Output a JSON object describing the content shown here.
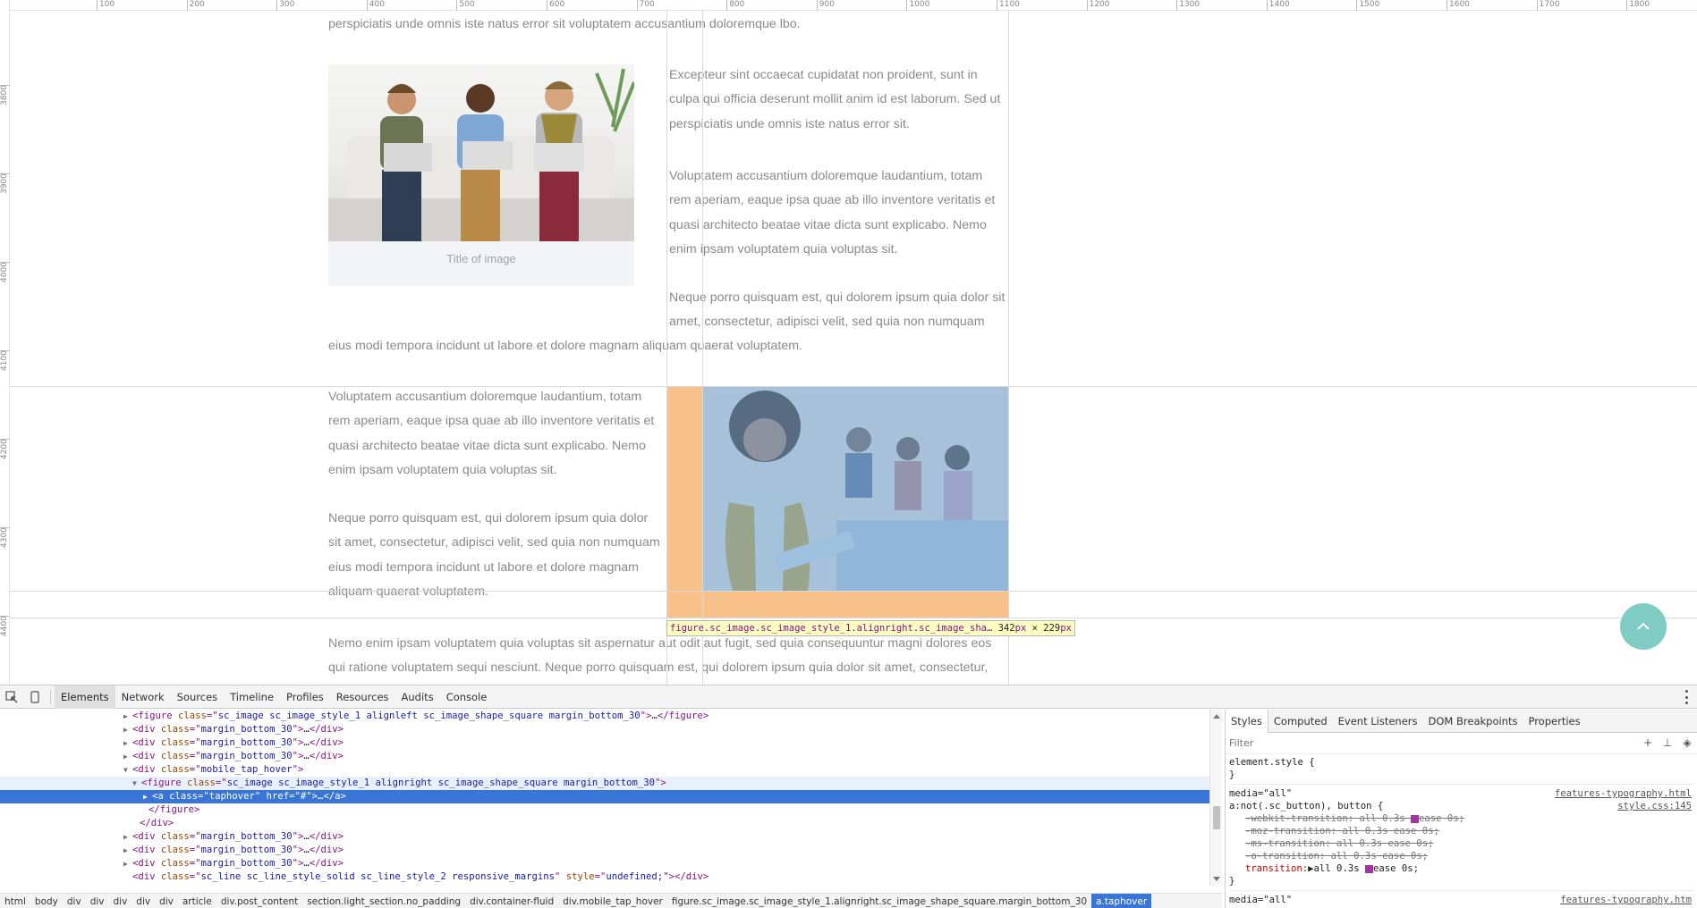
{
  "page": {
    "text_top": "perspiciatis unde omnis iste natus error sit voluptatem accusantium doloremque lbo.",
    "right_paragraphs": [
      "Excepteur sint occaecat cupidatat non proident, sunt in culpa qui officia deserunt mollit anim id est laborum. Sed ut perspiciatis unde omnis iste natus error sit.",
      "Voluptatem accusantium doloremque laudantium, totam rem aperiam, eaque ipsa quae ab illo inventore veritatis et quasi architecto beatae vitae dicta sunt explicabo. Nemo enim ipsam voluptatem quia voluptas sit.",
      "Neque porro quisquam est, qui dolorem ipsum quia dolor sit amet, consectetur, adipisci velit, sed quia non numquam"
    ],
    "wrap_line": "eius modi tempora incidunt ut labore et dolore magnam aliquam quaerat voluptatem.",
    "image_caption": "Title of image",
    "left_paragraphs": [
      "Voluptatem accusantium doloremque laudantium, totam rem aperiam, eaque ipsa quae ab illo inventore veritatis et quasi architecto beatae vitae dicta sunt explicabo. Nemo enim ipsam voluptatem quia voluptas sit.",
      "Neque porro quisquam est, qui dolorem ipsum quia dolor sit amet, consectetur, adipisci velit, sed quia non numquam eius modi tempora incidunt ut labore et dolore magnam aliquam quaerat voluptatem."
    ],
    "bottom_paragraph": "Nemo enim ipsam voluptatem quia voluptas sit aspernatur aut odit aut fugit, sed quia consequuntur magni dolores eos qui ratione voluptatem sequi nesciunt. Neque porro quisquam est, qui dolorem ipsum quia dolor sit amet, consectetur, adipisci velit, sed quia non",
    "scroll_top_icon": "chevron-up-icon",
    "accent_color": "#7fccc5"
  },
  "rulers": {
    "horizontal": [
      "100",
      "200",
      "300",
      "400",
      "500",
      "600",
      "700",
      "800",
      "900",
      "1000",
      "1100",
      "1200",
      "1300",
      "1400",
      "1500",
      "1600",
      "1700",
      "1800"
    ],
    "vertical": [
      "3800",
      "3900",
      "4000",
      "4100",
      "4200",
      "4300",
      "4400"
    ]
  },
  "inspect_tooltip": {
    "selector": "figure.sc_image.sc_image_style_1.alignright.sc_image_sha…",
    "width": "342",
    "height": "229",
    "unit": "px",
    "times": "×"
  },
  "devtools": {
    "tabs": [
      "Elements",
      "Network",
      "Sources",
      "Timeline",
      "Profiles",
      "Resources",
      "Audits",
      "Console"
    ],
    "active_tab": "Elements",
    "dom_lines": [
      {
        "tri": "▶",
        "html": [
          [
            "t",
            "<figure "
          ],
          [
            "an",
            "class"
          ],
          [
            "t",
            "=\""
          ],
          [
            "av",
            "sc_image sc_image_style_1 alignleft sc_image_shape_square margin_bottom_30"
          ],
          [
            "t",
            "\">"
          ],
          [
            "el",
            "…"
          ],
          [
            "t",
            "</figure>"
          ]
        ]
      },
      {
        "tri": "▶",
        "html": [
          [
            "t",
            "<div "
          ],
          [
            "an",
            "class"
          ],
          [
            "t",
            "=\""
          ],
          [
            "av",
            "margin_bottom_30"
          ],
          [
            "t",
            "\">"
          ],
          [
            "el",
            "…"
          ],
          [
            "t",
            "</div>"
          ]
        ]
      },
      {
        "tri": "▶",
        "html": [
          [
            "t",
            "<div "
          ],
          [
            "an",
            "class"
          ],
          [
            "t",
            "=\""
          ],
          [
            "av",
            "margin_bottom_30"
          ],
          [
            "t",
            "\">"
          ],
          [
            "el",
            "…"
          ],
          [
            "t",
            "</div>"
          ]
        ]
      },
      {
        "tri": "▶",
        "html": [
          [
            "t",
            "<div "
          ],
          [
            "an",
            "class"
          ],
          [
            "t",
            "=\""
          ],
          [
            "av",
            "margin_bottom_30"
          ],
          [
            "t",
            "\">"
          ],
          [
            "el",
            "…"
          ],
          [
            "t",
            "</div>"
          ]
        ]
      },
      {
        "tri": "▼",
        "html": [
          [
            "t",
            "<div "
          ],
          [
            "an",
            "class"
          ],
          [
            "t",
            "=\""
          ],
          [
            "av",
            "mobile_tap_hover"
          ],
          [
            "t",
            "\">"
          ]
        ]
      },
      {
        "tri": "▼",
        "html": [
          [
            "t",
            "<figure "
          ],
          [
            "an",
            "class"
          ],
          [
            "t",
            "=\""
          ],
          [
            "av",
            "sc_image sc_image_style_1 alignright sc_image_shape_square margin_bottom_30"
          ],
          [
            "t",
            "\">"
          ]
        ]
      },
      {
        "tri": "▶",
        "html": [
          [
            "t",
            "<a "
          ],
          [
            "an",
            "class"
          ],
          [
            "t",
            "=\""
          ],
          [
            "av",
            "taphover"
          ],
          [
            "t",
            "\" "
          ],
          [
            "an",
            "href"
          ],
          [
            "t",
            "=\""
          ],
          [
            "av",
            "#"
          ],
          [
            "t",
            "\">"
          ],
          [
            "el",
            "…"
          ],
          [
            "t",
            "</a>"
          ]
        ]
      },
      {
        "tri": "",
        "html": [
          [
            "t",
            "</figure>"
          ]
        ]
      },
      {
        "tri": "",
        "html": [
          [
            "t",
            "</div>"
          ]
        ]
      },
      {
        "tri": "▶",
        "html": [
          [
            "t",
            "<div "
          ],
          [
            "an",
            "class"
          ],
          [
            "t",
            "=\""
          ],
          [
            "av",
            "margin_bottom_30"
          ],
          [
            "t",
            "\">"
          ],
          [
            "el",
            "…"
          ],
          [
            "t",
            "</div>"
          ]
        ]
      },
      {
        "tri": "▶",
        "html": [
          [
            "t",
            "<div "
          ],
          [
            "an",
            "class"
          ],
          [
            "t",
            "=\""
          ],
          [
            "av",
            "margin_bottom_30"
          ],
          [
            "t",
            "\">"
          ],
          [
            "el",
            "…"
          ],
          [
            "t",
            "</div>"
          ]
        ]
      },
      {
        "tri": "▶",
        "html": [
          [
            "t",
            "<div "
          ],
          [
            "an",
            "class"
          ],
          [
            "t",
            "=\""
          ],
          [
            "av",
            "margin_bottom_30"
          ],
          [
            "t",
            "\">"
          ],
          [
            "el",
            "…"
          ],
          [
            "t",
            "</div>"
          ]
        ]
      },
      {
        "tri": "",
        "html": [
          [
            "t",
            "<div "
          ],
          [
            "an",
            "class"
          ],
          [
            "t",
            "=\""
          ],
          [
            "av",
            "sc_line sc_line_style_solid sc_line_style_2 responsive_margins"
          ],
          [
            "t",
            "\" "
          ],
          [
            "an",
            "style"
          ],
          [
            "t",
            "=\""
          ],
          [
            "av",
            "undefined;"
          ],
          [
            "t",
            "\"></div>"
          ]
        ]
      }
    ],
    "breadcrumbs": [
      "html",
      "body",
      "div",
      "div",
      "div",
      "div",
      "div",
      "article",
      "div.post_content",
      "section.light_section.no_padding",
      "div.container-fluid",
      "div.mobile_tap_hover",
      "figure.sc_image.sc_image_style_1.alignright.sc_image_shape_square.margin_bottom_30",
      "a.taphover"
    ],
    "styles_tabs": [
      "Styles",
      "Computed",
      "Event Listeners",
      "DOM Breakpoints",
      "Properties"
    ],
    "filter_placeholder": "Filter",
    "style_rules": {
      "element_style": "element.style {",
      "close": "}",
      "media": "media=\"all\"",
      "link_1": "features-typography.html",
      "selector": "a:not(.sc_button), button {",
      "link_2": "style.css:145",
      "props": [
        "-webkit-transition: all 0.3s ",
        "-moz-transition: all 0.3s ease 0s;",
        "-ms-transition: all 0.3s ease 0s;",
        "-o-transition: all 0.3s ease 0s;"
      ],
      "webkit_tail": "ease 0s;",
      "transition_name": "transition:",
      "transition_value": "▶all 0.3s ",
      "transition_tail": "ease 0s;",
      "media_2": "media=\"all\"",
      "link_3": "features-typography.htm"
    }
  }
}
